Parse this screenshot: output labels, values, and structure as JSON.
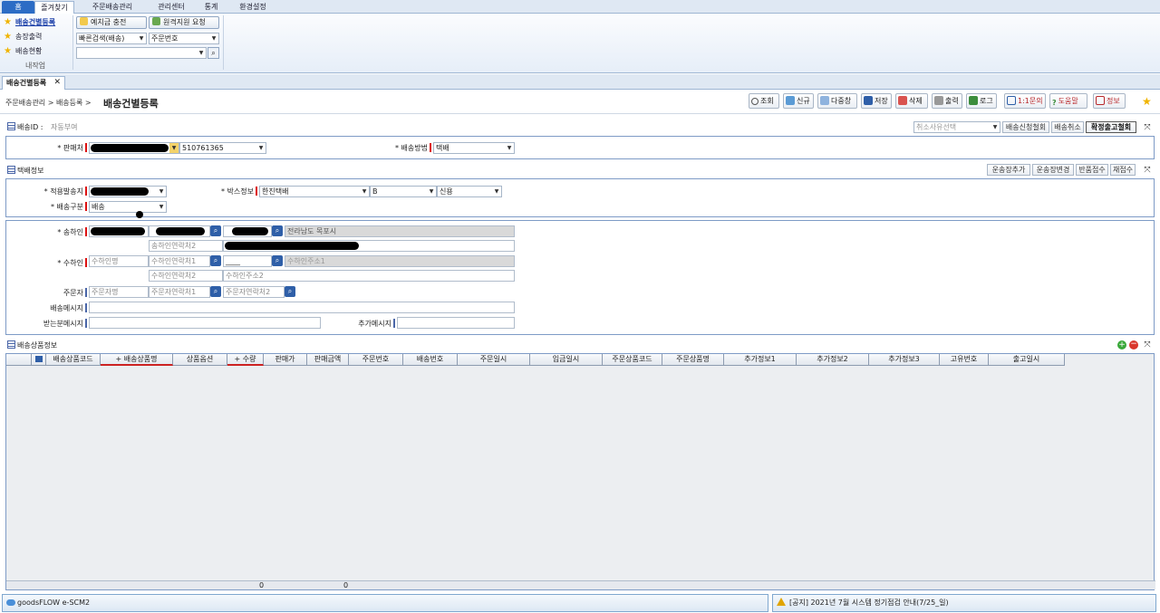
{
  "ribbon": {
    "tabs": [
      "홈",
      "즐겨찾기",
      "주문배송관리",
      "관리센터",
      "통계",
      "환경설정"
    ],
    "favorites": [
      "배송건별등록",
      "송장출력",
      "배송현황"
    ],
    "favorites_footer": "내작업",
    "buttons": [
      "예치금 충전",
      "원격지원 요청"
    ],
    "quick_search_type": "빠른검색(배송)",
    "quick_search_field": "주문번호",
    "quick_search_value": ""
  },
  "doc_tab": {
    "label": "배송건별등록"
  },
  "header": {
    "breadcrumb": "주문배송관리 > 배송등록 >",
    "title": "배송건별등록",
    "toolbar": [
      "조회",
      "신규",
      "다중창",
      "저장",
      "삭제",
      "출력",
      "로그",
      "1:1문의",
      "도움말",
      "정보"
    ]
  },
  "delivery_id": {
    "label": "배송ID :",
    "value": "자동부여",
    "cancel_reason_placeholder": "취소사유선택",
    "buttons": [
      "배송신청철회",
      "배송취소",
      "확정출고철회"
    ]
  },
  "seller_row": {
    "seller_label": "* 판매처",
    "seller_code": "510761365",
    "method_label": "* 배송방법",
    "method_value": "택배"
  },
  "courier": {
    "title": "택배정보",
    "buttons": [
      "운송장추가",
      "운송장변경",
      "반품접수",
      "재접수"
    ],
    "applied_label": "* 적용발송지",
    "box_label": "* 박스정보",
    "box_carrier": "한진택배",
    "box_size": "B",
    "box_payment": "신용",
    "delivery_type_label": "* 배송구분",
    "delivery_type_value": "배송"
  },
  "parties": {
    "sender_label": "* 송하인",
    "sender_address": "전라남도 목포시",
    "sender_phone2_placeholder": "송하인연락처2",
    "receiver_label": "* 수하인",
    "receiver_name_placeholder": "수하인명",
    "receiver_phone1_placeholder": "수하인연락처1",
    "receiver_phone2_placeholder": "수하인연락처2",
    "receiver_address1_placeholder": "수하인주소1",
    "receiver_address2_placeholder": "수하인주소2",
    "receiver_zip": "____",
    "orderer_label": "주문자",
    "orderer_name_placeholder": "주문자명",
    "orderer_phone1_placeholder": "주문자연락처1",
    "orderer_phone2_placeholder": "주문자연락처2",
    "delivery_msg_label": "배송메시지",
    "recipient_msg_label": "받는분메시지",
    "extra_msg_label": "추가메시지"
  },
  "items": {
    "title": "배송상품정보",
    "columns": [
      "배송상품코드",
      "+ 배송상품명",
      "상품옵션",
      "+ 수량",
      "판매가",
      "판매금액",
      "주문번호",
      "배송번호",
      "주문일시",
      "입금일시",
      "주문상품코드",
      "주문상품명",
      "추가정보1",
      "추가정보2",
      "추가정보3",
      "고유번호",
      "출고일시"
    ],
    "sum_qty": "0",
    "sum_amount": "0"
  },
  "status": {
    "left": "goodsFLOW e-SCM2",
    "right": "[공지] 2021년 7월 시스템 정기점검 안내(7/25_일)"
  }
}
